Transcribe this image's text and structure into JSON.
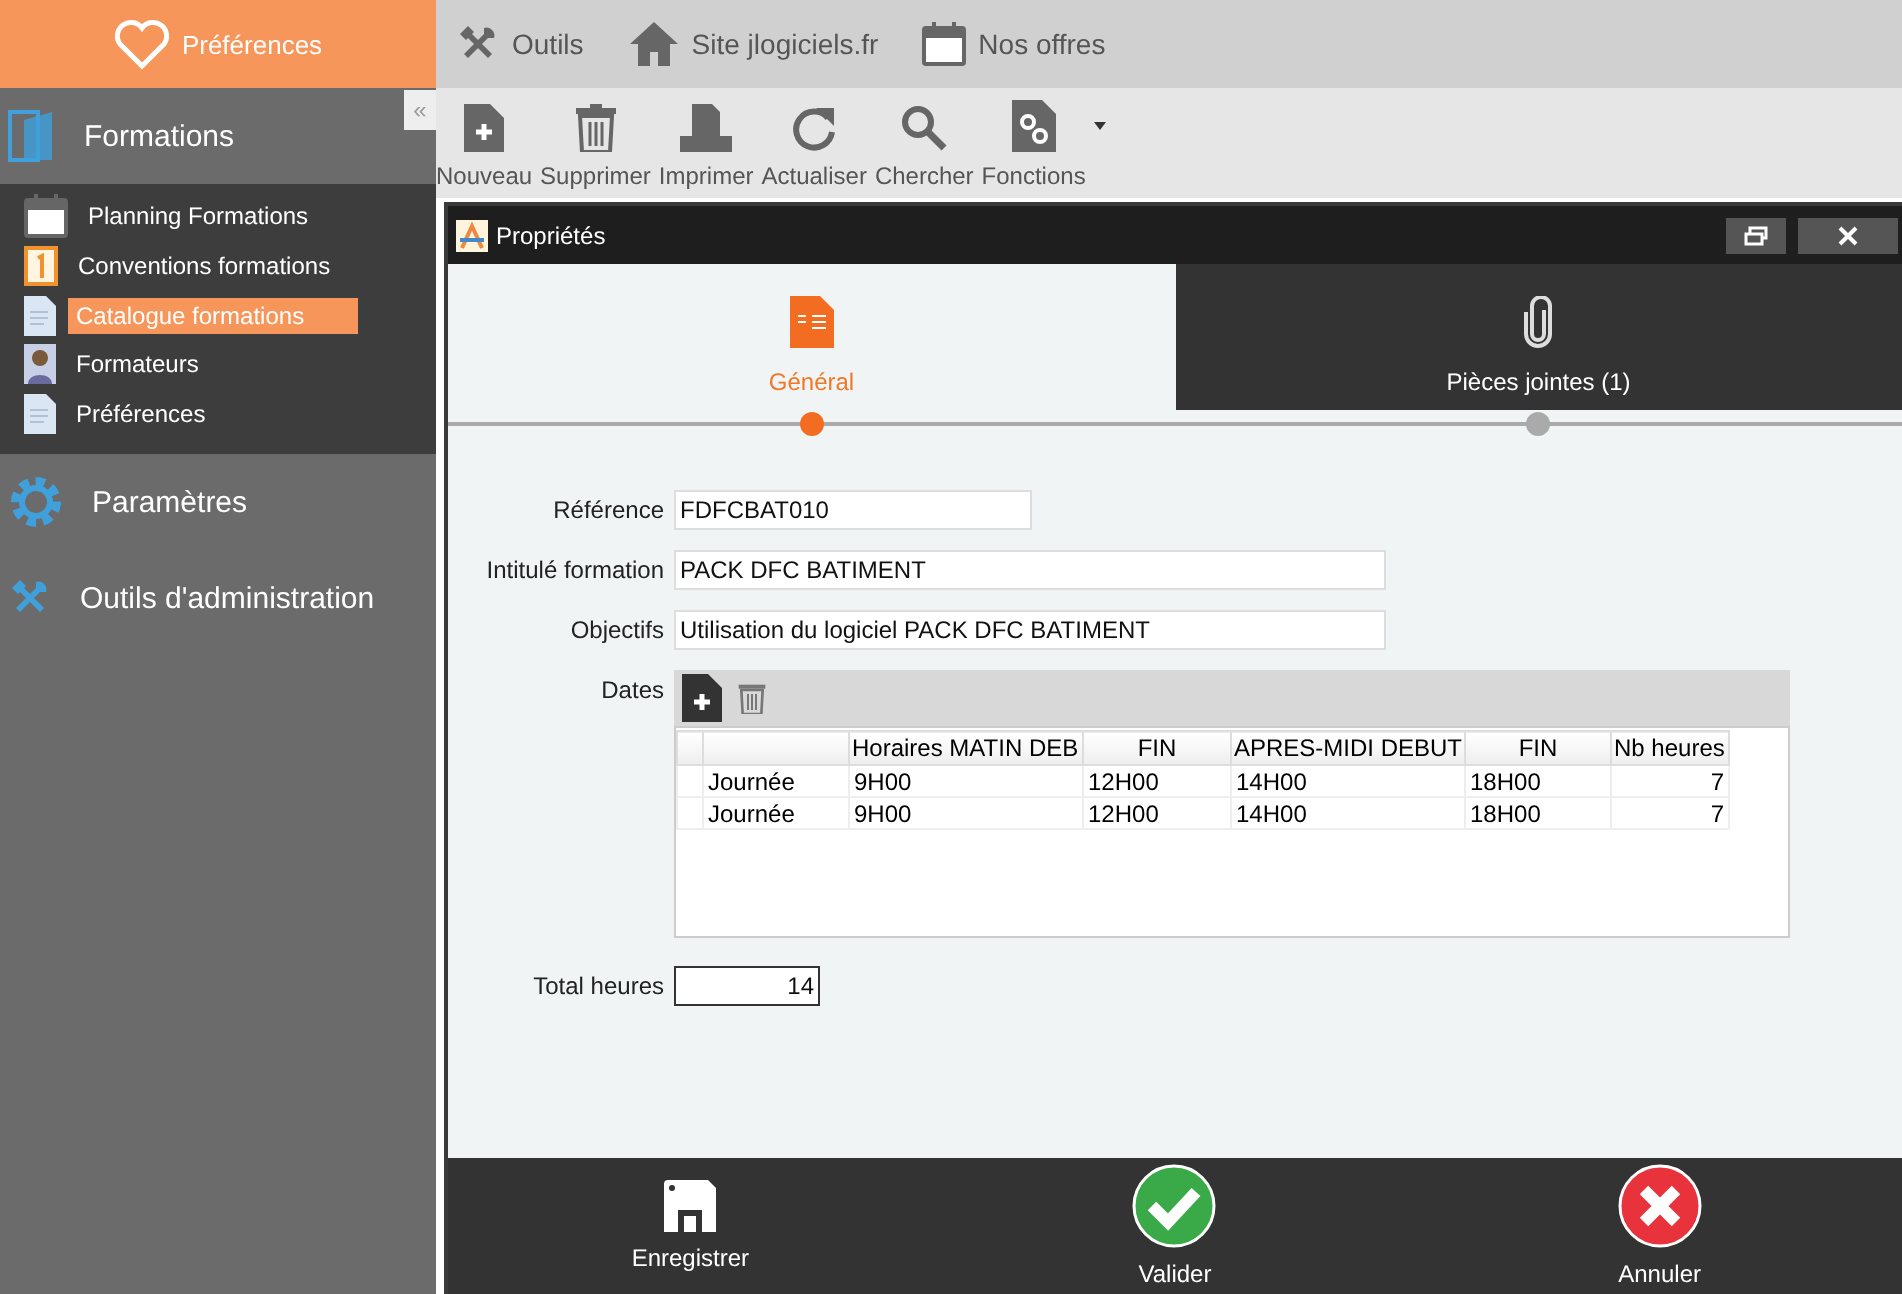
{
  "app_header": {
    "title": "Préférences"
  },
  "top_nav": [
    {
      "label": "Outils",
      "kind": "tools"
    },
    {
      "label": "Site jlogiciels.fr",
      "kind": "home"
    },
    {
      "label": "Nos offres",
      "kind": "calendar"
    }
  ],
  "toolbar": [
    {
      "label": "Nouveau",
      "kind": "new"
    },
    {
      "label": "Supprimer",
      "kind": "trash"
    },
    {
      "label": "Imprimer",
      "kind": "print"
    },
    {
      "label": "Actualiser",
      "kind": "refresh"
    },
    {
      "label": "Chercher",
      "kind": "search"
    },
    {
      "label": "Fonctions",
      "kind": "gear-doc"
    }
  ],
  "sidebar": [
    {
      "label": "Formations",
      "kind": "folder",
      "expanded": true,
      "children": [
        {
          "label": "Planning Formations",
          "kind": "calendar",
          "selected": false
        },
        {
          "label": "Conventions formations",
          "kind": "one",
          "selected": false
        },
        {
          "label": "Catalogue formations",
          "kind": "doc",
          "selected": true
        },
        {
          "label": "Formateurs",
          "kind": "person",
          "selected": false
        },
        {
          "label": "Préférences",
          "kind": "doc",
          "selected": false
        }
      ]
    },
    {
      "label": "Paramètres",
      "kind": "gear",
      "expanded": false
    },
    {
      "label": "Outils d'administration",
      "kind": "tools",
      "expanded": false
    }
  ],
  "sidebar_toggle": "«",
  "dialog": {
    "title": "Propriétés",
    "tabs": [
      {
        "label": "Général",
        "kind": "doc",
        "selected": true
      },
      {
        "label": "Pièces jointes (1)",
        "kind": "clip",
        "selected": false
      }
    ],
    "fields": [
      {
        "label": "Référence",
        "value": "FDFCBAT010",
        "kind": "short"
      },
      {
        "label": "Intitulé formation",
        "value": "PACK DFC BATIMENT",
        "kind": "long"
      },
      {
        "label": "Objectifs",
        "value": "Utilisation du logiciel PACK DFC BATIMENT",
        "kind": "long"
      }
    ],
    "dates": {
      "label": "Dates",
      "columns": [
        "",
        "Horaires MATIN DEB",
        "FIN",
        "APRES-MIDI DEBUT",
        "FIN",
        "Nb heures"
      ],
      "rows": [
        [
          "Journée",
          "9H00",
          "12H00",
          "14H00",
          "18H00",
          "7"
        ],
        [
          "Journée",
          "9H00",
          "12H00",
          "14H00",
          "18H00",
          "7"
        ]
      ]
    },
    "total": {
      "label": "Total heures",
      "value": "14"
    },
    "buttons": [
      {
        "label": "Enregistrer",
        "kind": "save"
      },
      {
        "label": "Valider",
        "kind": "ok"
      },
      {
        "label": "Annuler",
        "kind": "cancel"
      }
    ]
  }
}
